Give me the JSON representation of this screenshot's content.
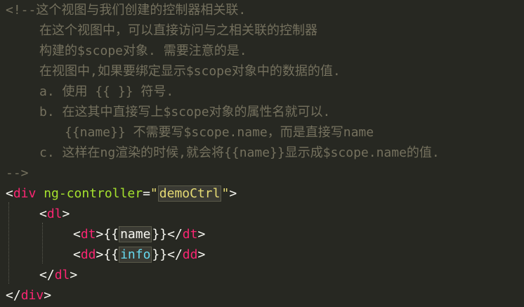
{
  "comment": {
    "l1": "<!--这个视图与我们创建的控制器相关联.",
    "l2": "在这个视图中，可以直接访问与之相关联的控制器",
    "l3": "构建的$scope对象. 需要注意的是.",
    "l4": "在视图中,如果要绑定显示$scope对象中的数据的值.",
    "l5": "a. 使用 {{ }} 符号.",
    "l6": "b. 在这其中直接写上$scope对象的属性名就可以.",
    "l7": "{{name}} 不需要写$scope.name，而是直接写name",
    "l8": "c. 这样在ng渲染的时候,就会将{{name}}显示成$scope.name的值.",
    "l9": "-->"
  },
  "code": {
    "div_open_lt": "<",
    "div_name": "div",
    "div_attr": " ng-controller",
    "div_eq": "=",
    "div_q1": "\"",
    "div_value": "demoCtrl",
    "div_q2": "\"",
    "div_gt": ">",
    "dl_open_lt": "<",
    "dl_name": "dl",
    "dl_gt": ">",
    "dt_lt": "<",
    "dt_name": "dt",
    "dt_gt": ">",
    "dt_open_brace": "{{",
    "dt_expr": "name",
    "dt_close_brace": "}}",
    "dt_close_lt": "</",
    "dt_close_name": "dt",
    "dt_close_gt": ">",
    "dd_lt": "<",
    "dd_name": "dd",
    "dd_gt": ">",
    "dd_open_brace": "{{",
    "dd_expr": "info",
    "dd_close_brace": "}}",
    "dd_close_lt": "</",
    "dd_close_name": "dd",
    "dd_close_gt": ">",
    "dl_close_lt": "</",
    "dl_close_name": "dl",
    "dl_close_gt": ">",
    "div_close_lt": "</",
    "div_close_name": "div",
    "div_close_gt": ">"
  },
  "colors": {
    "background": "#272822",
    "comment": "#75715e",
    "tag": "#f92672",
    "attribute": "#a6e22e",
    "string": "#e6db74",
    "plain": "#f8f8f2",
    "expression": "#66d9ef"
  }
}
